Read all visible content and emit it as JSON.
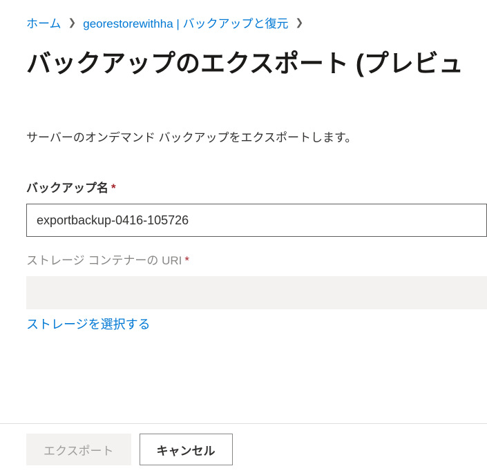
{
  "breadcrumb": {
    "home": "ホーム",
    "server": "georestorewithha | バックアップと復元"
  },
  "page_title": "バックアップのエクスポート (プレビュ",
  "description": "サーバーのオンデマンド バックアップをエクスポートします。",
  "form": {
    "backup_name_label": "バックアップ名",
    "backup_name_value": "exportbackup-0416-105726",
    "storage_uri_label": "ストレージ コンテナーの URI",
    "storage_uri_value": "",
    "select_storage_link": "ストレージを選択する"
  },
  "footer": {
    "export_button": "エクスポート",
    "cancel_button": "キャンセル"
  }
}
